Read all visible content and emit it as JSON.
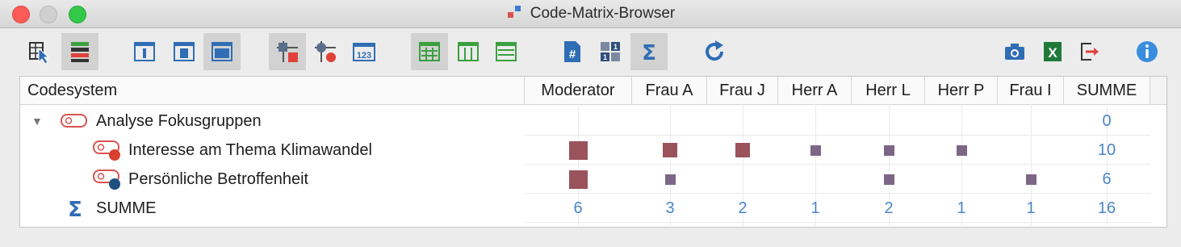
{
  "window": {
    "title": "Code-Matrix-Browser"
  },
  "toolbar": {
    "buttons": [
      {
        "icon": "select-cursor-icon",
        "active": false
      },
      {
        "icon": "rows-colored-icon",
        "active": true
      },
      {
        "icon": "view-narrow-icon",
        "active": false
      },
      {
        "icon": "view-medium-icon",
        "active": false
      },
      {
        "icon": "view-wide-icon",
        "active": true
      },
      {
        "icon": "symbol-squares-icon",
        "active": true
      },
      {
        "icon": "symbol-circles-icon",
        "active": false
      },
      {
        "icon": "numbers-123-icon",
        "active": false
      },
      {
        "icon": "grid-hash-icon",
        "active": true
      },
      {
        "icon": "columns-icon",
        "active": false
      },
      {
        "icon": "rows-lines-icon",
        "active": false
      },
      {
        "icon": "hash-document-icon",
        "active": false
      },
      {
        "icon": "matrix-ones-icon",
        "active": false
      },
      {
        "icon": "sigma-icon",
        "active": true
      },
      {
        "icon": "refresh-icon",
        "active": false
      },
      {
        "icon": "camera-icon",
        "active": false
      },
      {
        "icon": "excel-export-icon",
        "active": false
      },
      {
        "icon": "export-icon",
        "active": false
      },
      {
        "icon": "info-icon",
        "active": false
      }
    ]
  },
  "colors": {
    "accent_blue": "#4a86c8",
    "square_red": "#9a535b",
    "square_purple": "#7d6685"
  },
  "table": {
    "headers": [
      "Codesystem",
      "Moderator",
      "Frau A",
      "Frau J",
      "Herr A",
      "Herr L",
      "Herr P",
      "Frau I",
      "SUMME"
    ],
    "rows": [
      {
        "label": "Analyse Fokusgruppen",
        "icon": "code-parent-icon",
        "expander": "▼",
        "cells": [
          0,
          0,
          0,
          0,
          0,
          0,
          0
        ],
        "total": "0"
      },
      {
        "label": "Interesse am Thema Klimawandel",
        "icon": "code-red-icon",
        "cells": [
          3,
          2,
          2,
          1,
          1,
          1,
          0
        ],
        "total": "10"
      },
      {
        "label": "Persönliche Betroffenheit",
        "icon": "code-blue-icon",
        "cells": [
          3,
          1,
          0,
          0,
          1,
          0,
          1
        ],
        "total": "6"
      }
    ],
    "summe": {
      "label": "SUMME",
      "icon": "sigma-icon",
      "values": [
        "6",
        "3",
        "2",
        "1",
        "2",
        "1",
        "1"
      ],
      "total": "16"
    }
  }
}
